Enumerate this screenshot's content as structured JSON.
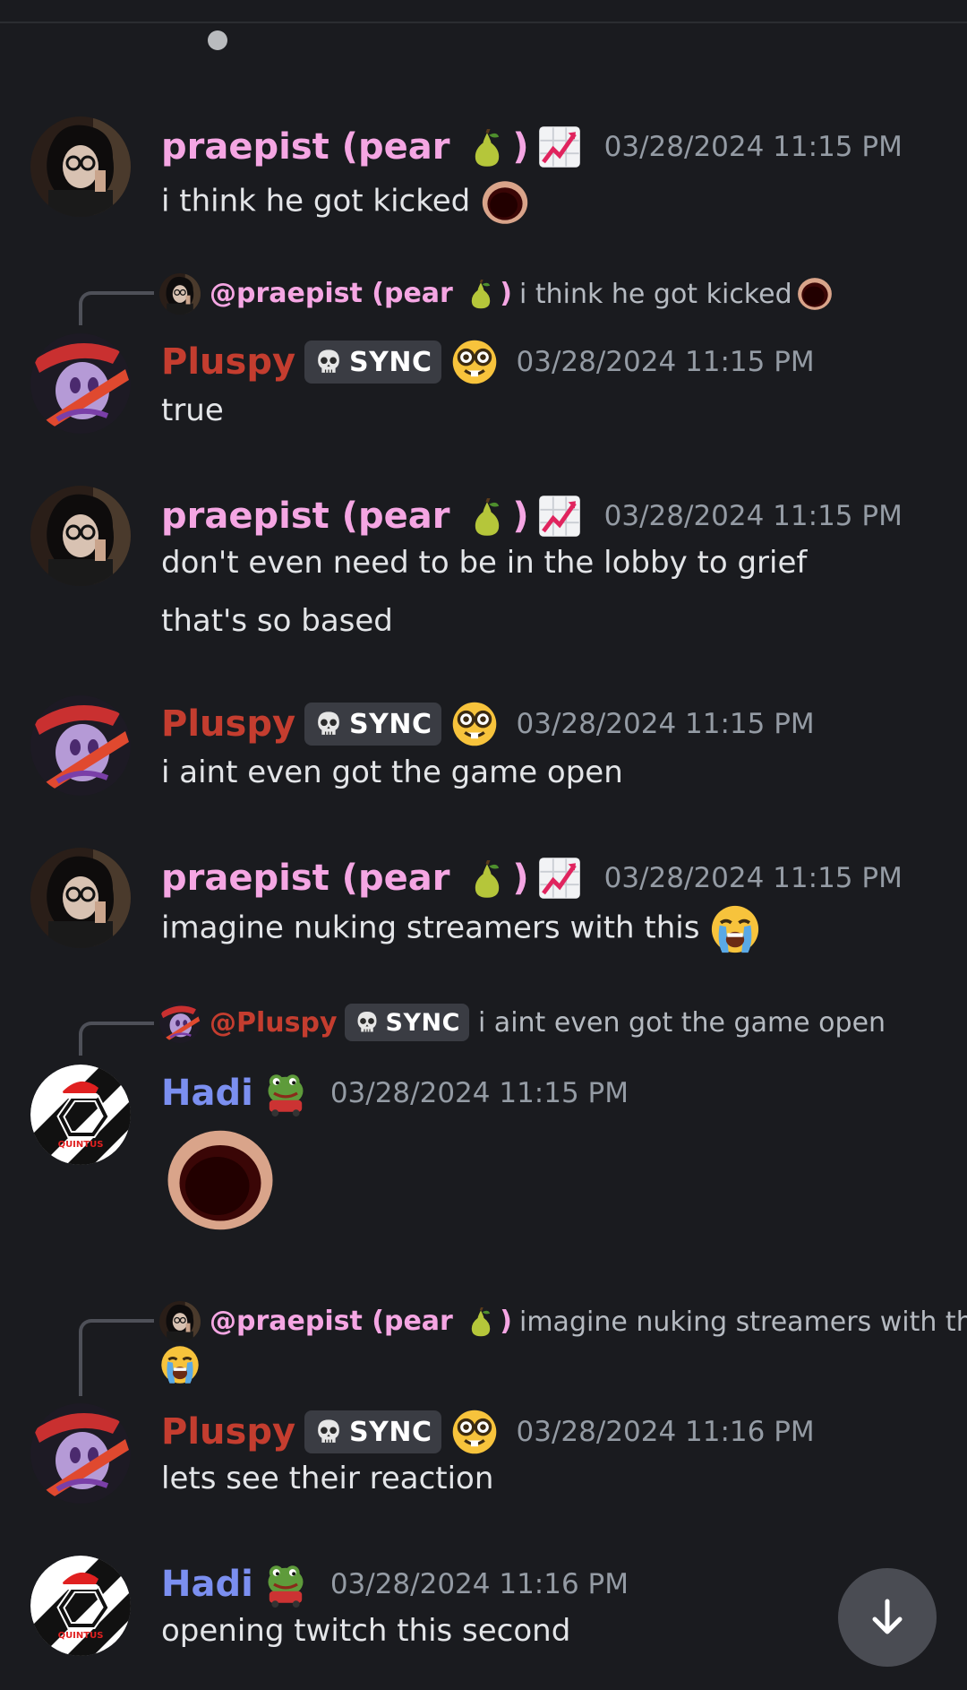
{
  "users": {
    "praepist": {
      "name": "praepist (pear ",
      "paren": ")",
      "reply_name": "@praepist (pear "
    },
    "pluspy": {
      "name": "Pluspy",
      "reply_name": "@Pluspy",
      "tag": "SYNC"
    },
    "hadi": {
      "name": "Hadi"
    }
  },
  "messages": [
    {
      "timestamp": "03/28/2024 11:15 PM",
      "lines": [
        "i think he got kicked"
      ]
    },
    {
      "reply_text": "i think he got kicked",
      "timestamp": "03/28/2024 11:15 PM",
      "lines": [
        "true"
      ]
    },
    {
      "timestamp": "03/28/2024 11:15 PM",
      "lines": [
        "don't even need to be in the lobby to grief",
        "that's so based"
      ]
    },
    {
      "timestamp": "03/28/2024 11:15 PM",
      "lines": [
        "i aint even got the game open"
      ]
    },
    {
      "timestamp": "03/28/2024 11:15 PM",
      "lines": [
        "imagine nuking streamers with this"
      ]
    },
    {
      "reply_text": "i aint even got the game open",
      "timestamp": "03/28/2024 11:15 PM",
      "lines": []
    },
    {
      "reply_text": "imagine nuking streamers with this",
      "timestamp": "03/28/2024 11:16 PM",
      "lines": [
        "lets see their reaction"
      ]
    },
    {
      "timestamp": "03/28/2024 11:16 PM",
      "lines": [
        "opening twitch this second"
      ]
    }
  ],
  "colors": {
    "background": "#1a1b1f",
    "pink_name": "#f5a6e3",
    "red_name": "#c43d2f",
    "blue_name": "#7b8ff0",
    "timestamp": "#949ba4"
  },
  "icons": [
    "pear-emoji",
    "chart-increasing-emoji",
    "hole-emoji",
    "nerd-face-emoji",
    "skull-icon",
    "frog-emoji",
    "loudly-crying-emoji",
    "arrow-down-icon"
  ]
}
